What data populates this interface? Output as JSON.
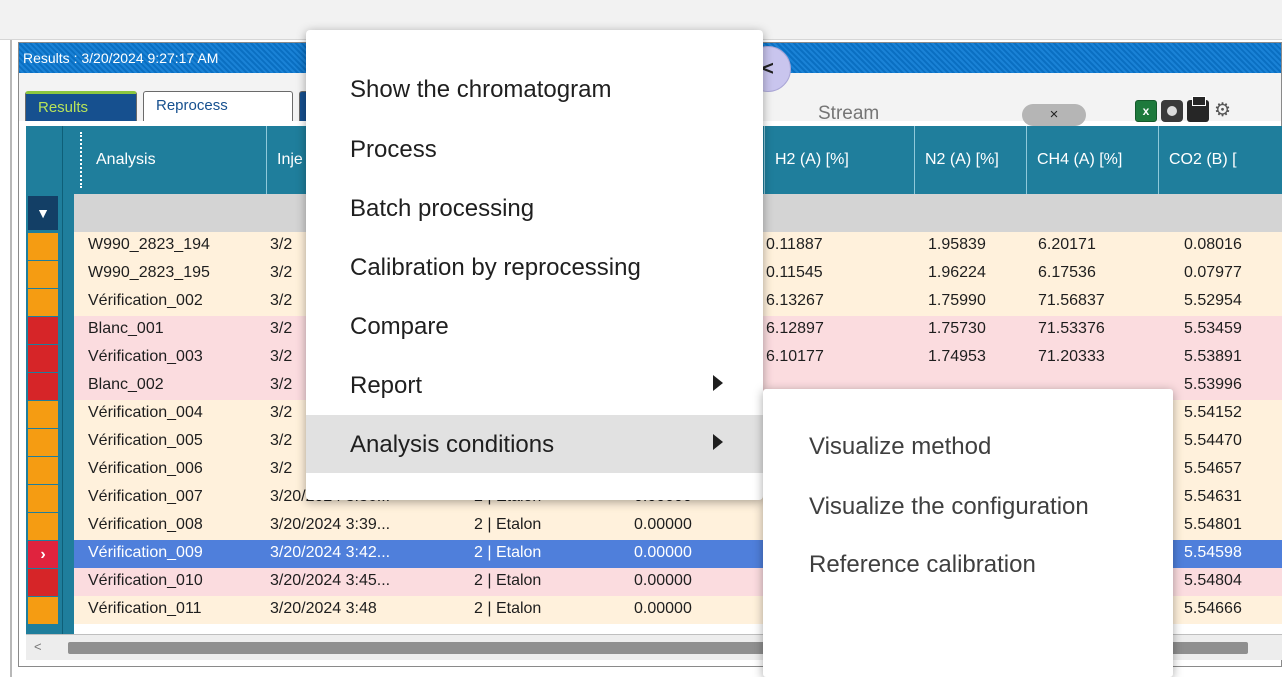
{
  "panel": {
    "title": "Results : 3/20/2024 9:27:17 AM",
    "tabs": [
      {
        "label": "Results",
        "active": true
      },
      {
        "label": "Reprocess",
        "active": false
      }
    ]
  },
  "toolbar": {
    "stream_button_icon": "branch-icon",
    "stream_placeholder": "Stream",
    "clear_label": "×",
    "excel_label": "x",
    "gear_glyph": "⚙"
  },
  "grid": {
    "columns": [
      "Analysis",
      "Inje",
      "H2 (A) [%]",
      "N2 (A) [%]",
      "CH4 (A) [%]",
      "CO2 (B) ["
    ],
    "filter_glyph": "▼",
    "current_row_glyph": "›",
    "status_colors": {
      "orange": "#f59c12",
      "red": "#d62528"
    },
    "row_tint_colors": {
      "orange": "#fff1dc",
      "red": "#fbdcdf",
      "selected": "#4f7fdb"
    },
    "rows": [
      {
        "status": "orange",
        "tint": "orange",
        "analysis": "W990_2823_194",
        "injection": "3/2",
        "type": "",
        "value": "",
        "h2": "0.11887",
        "n2": "1.95839",
        "ch4": "6.20171",
        "co2": "0.08016"
      },
      {
        "status": "orange",
        "tint": "orange",
        "analysis": "W990_2823_195",
        "injection": "3/2",
        "type": "",
        "value": "",
        "h2": "0.11545",
        "n2": "1.96224",
        "ch4": "6.17536",
        "co2": "0.07977"
      },
      {
        "status": "orange",
        "tint": "orange",
        "analysis": "Vérification_002",
        "injection": "3/2",
        "type": "",
        "value": "",
        "h2": "6.13267",
        "n2": "1.75990",
        "ch4": "71.56837",
        "co2": "5.52954"
      },
      {
        "status": "red",
        "tint": "red",
        "analysis": "Blanc_001",
        "injection": "3/2",
        "type": "",
        "value": "",
        "h2": "6.12897",
        "n2": "1.75730",
        "ch4": "71.53376",
        "co2": "5.53459"
      },
      {
        "status": "red",
        "tint": "red",
        "analysis": "Vérification_003",
        "injection": "3/2",
        "type": "",
        "value": "",
        "h2": "6.10177",
        "n2": "1.74953",
        "ch4": "71.20333",
        "co2": "5.53891"
      },
      {
        "status": "red",
        "tint": "red",
        "analysis": "Blanc_002",
        "injection": "3/2",
        "type": "",
        "value": "",
        "h2": "",
        "n2": "",
        "ch4": "",
        "co2": "5.53996"
      },
      {
        "status": "orange",
        "tint": "orange",
        "analysis": "Vérification_004",
        "injection": "3/2",
        "type": "",
        "value": "",
        "h2": "",
        "n2": "",
        "ch4": "",
        "co2": "5.54152"
      },
      {
        "status": "orange",
        "tint": "orange",
        "analysis": "Vérification_005",
        "injection": "3/2",
        "type": "",
        "value": "",
        "h2": "",
        "n2": "",
        "ch4": "",
        "co2": "5.54470"
      },
      {
        "status": "orange",
        "tint": "orange",
        "analysis": "Vérification_006",
        "injection": "3/2",
        "type": "",
        "value": "",
        "h2": "",
        "n2": "",
        "ch4": "",
        "co2": "5.54657"
      },
      {
        "status": "orange",
        "tint": "orange",
        "analysis": "Vérification_007",
        "injection": "3/20/2024 3:36...",
        "type": "2 | Etalon",
        "value": "0.00000",
        "h2": "",
        "n2": "",
        "ch4": "",
        "co2": "5.54631"
      },
      {
        "status": "orange",
        "tint": "orange",
        "analysis": "Vérification_008",
        "injection": "3/20/2024 3:39...",
        "type": "2 | Etalon",
        "value": "0.00000",
        "h2": "",
        "n2": "",
        "ch4": "",
        "co2": "5.54801"
      },
      {
        "status": "current",
        "tint": "selected",
        "analysis": "Vérification_009",
        "injection": "3/20/2024 3:42...",
        "type": "2 | Etalon",
        "value": "0.00000",
        "h2": "",
        "n2": "",
        "ch4": "",
        "co2": "5.54598"
      },
      {
        "status": "red",
        "tint": "red",
        "analysis": "Vérification_010",
        "injection": "3/20/2024 3:45...",
        "type": "2 | Etalon",
        "value": "0.00000",
        "h2": "",
        "n2": "",
        "ch4": "",
        "co2": "5.54804"
      },
      {
        "status": "orange",
        "tint": "orange",
        "analysis": "Vérification_011",
        "injection": "3/20/2024 3:48",
        "type": "2 | Etalon",
        "value": "0.00000",
        "h2": "",
        "n2": "",
        "ch4": "",
        "co2": "5.54666"
      }
    ],
    "scroll_left_glyph": "<"
  },
  "context_menu": {
    "items": [
      {
        "label": "Show the chromatogram",
        "has_submenu": false
      },
      {
        "label": "Process",
        "has_submenu": false
      },
      {
        "label": "Batch processing",
        "has_submenu": false
      },
      {
        "label": "Calibration by reprocessing",
        "has_submenu": false
      },
      {
        "label": "Compare",
        "has_submenu": false
      },
      {
        "label": "Report",
        "has_submenu": true
      },
      {
        "label": "Analysis conditions",
        "has_submenu": true,
        "hovered": true
      }
    ]
  },
  "submenu": {
    "items": [
      {
        "label": "Visualize method"
      },
      {
        "label": "Visualize the configuration"
      },
      {
        "label": "Reference calibration"
      }
    ]
  }
}
